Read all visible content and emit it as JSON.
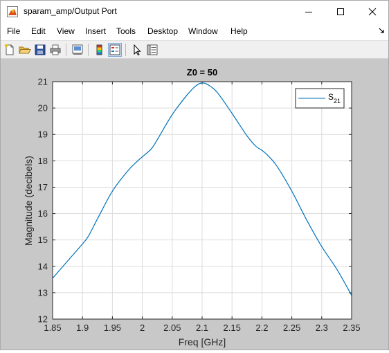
{
  "window": {
    "title": "sparam_amp/Output Port",
    "icons": {
      "app": "matlab-figure-icon",
      "minimize": "minimize-icon",
      "maximize": "maximize-icon",
      "close": "close-icon"
    }
  },
  "menubar": {
    "items": [
      "File",
      "Edit",
      "View",
      "Insert",
      "Tools",
      "Desktop",
      "Window",
      "Help"
    ],
    "dock_icon": "dock-arrow-icon"
  },
  "toolbar": {
    "items": [
      "new-figure-icon",
      "open-file-icon",
      "save-icon",
      "print-icon",
      "print-preview-icon",
      "colorbar-icon",
      "legend-icon",
      "edit-plot-icon",
      "property-inspector-icon"
    ],
    "active": "legend-icon"
  },
  "chart_data": {
    "type": "line",
    "title": "Z0 = 50",
    "xlabel": "Freq [GHz]",
    "ylabel": "Magnitude (decibels)",
    "xlim": [
      1.85,
      2.35
    ],
    "ylim": [
      12,
      21
    ],
    "xticks": [
      "1.85",
      "1.9",
      "1.95",
      "2",
      "2.05",
      "2.1",
      "2.15",
      "2.2",
      "2.25",
      "2.3",
      "2.35"
    ],
    "yticks": [
      "12",
      "13",
      "14",
      "15",
      "16",
      "17",
      "18",
      "19",
      "20",
      "21"
    ],
    "grid": true,
    "legend": {
      "position": "top-right",
      "label_main": "S",
      "label_sub": "21"
    },
    "series": [
      {
        "name": "S21",
        "color": "#0072bd",
        "x": [
          1.85,
          1.875,
          1.9,
          1.91,
          1.925,
          1.95,
          1.975,
          1.99,
          2.0,
          2.015,
          2.025,
          2.05,
          2.075,
          2.09,
          2.1,
          2.11,
          2.125,
          2.15,
          2.175,
          2.19,
          2.2,
          2.21,
          2.225,
          2.25,
          2.275,
          2.3,
          2.325,
          2.35
        ],
        "y": [
          13.55,
          14.2,
          14.85,
          15.15,
          15.8,
          16.85,
          17.6,
          17.95,
          18.15,
          18.45,
          18.8,
          19.75,
          20.5,
          20.85,
          20.95,
          20.88,
          20.6,
          19.8,
          18.95,
          18.55,
          18.4,
          18.2,
          17.8,
          16.85,
          15.75,
          14.75,
          13.9,
          12.9
        ]
      }
    ]
  }
}
